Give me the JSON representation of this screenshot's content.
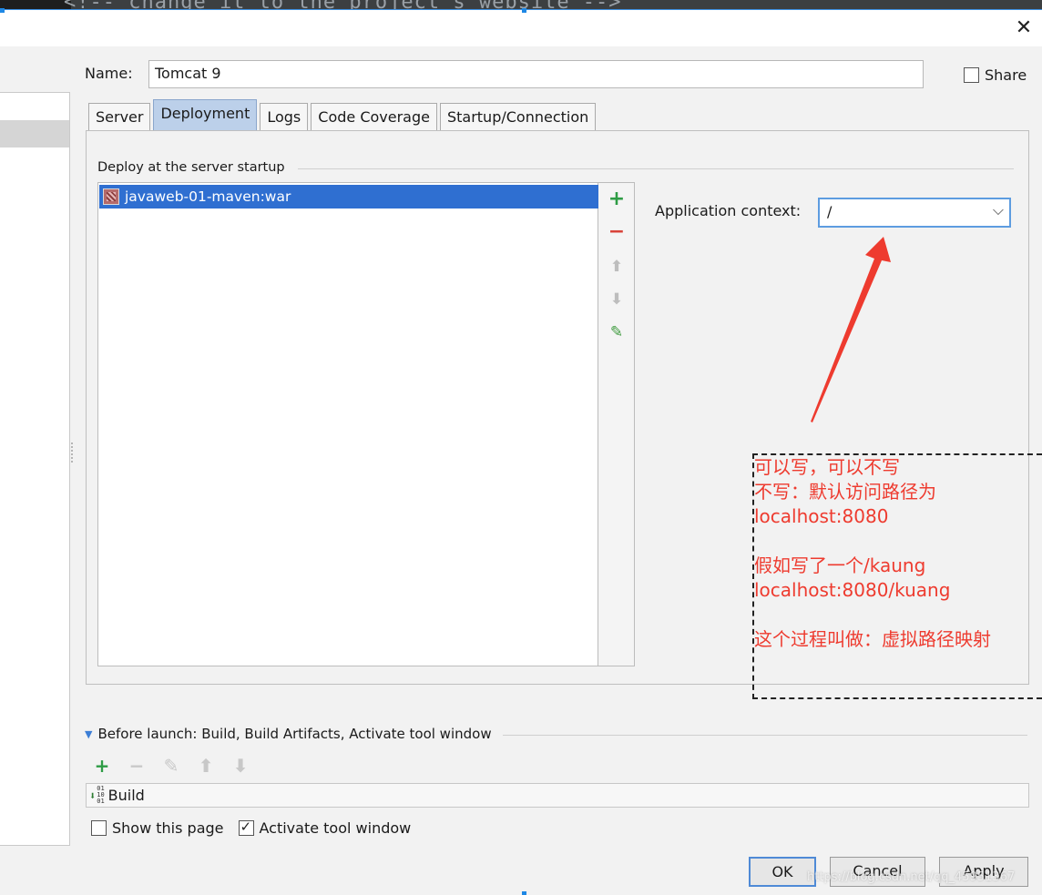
{
  "background_editor": {
    "code_line": "<!-- change it to the project's website -->"
  },
  "dialog": {
    "close_glyph": "✕",
    "name_label": "Name:",
    "name_value": "Tomcat 9",
    "share_label": "Share",
    "share_checked": false,
    "tabs": [
      {
        "label": "Server",
        "active": false
      },
      {
        "label": "Deployment",
        "active": true
      },
      {
        "label": "Logs",
        "active": false
      },
      {
        "label": "Code Coverage",
        "active": false
      },
      {
        "label": "Startup/Connection",
        "active": false
      }
    ],
    "deployment": {
      "section_title": "Deploy at the server startup",
      "artifacts": [
        {
          "name": "javaweb-01-maven:war",
          "icon": "war-artifact-icon",
          "selected": true
        }
      ],
      "toolbar": [
        {
          "name": "add-icon",
          "glyph": "+"
        },
        {
          "name": "remove-icon",
          "glyph": "−"
        },
        {
          "name": "move-up-icon",
          "glyph": "⬆"
        },
        {
          "name": "move-down-icon",
          "glyph": "⬇"
        },
        {
          "name": "edit-icon",
          "glyph": "✎"
        }
      ],
      "context_label": "Application context:",
      "context_value": "/",
      "context_chevron": "⌵"
    },
    "annotation": {
      "color": "#ee3b2f",
      "lines": [
        "可以写，可以不写",
        "不写：默认访问路径为",
        "localhost:8080",
        "",
        "假如写了一个/kaung",
        "localhost:8080/kuang",
        "",
        "这个过程叫做：虚拟路径映射"
      ]
    },
    "before_launch": {
      "label": "Before launch: Build, Build Artifacts, Activate tool window",
      "toolbar": [
        {
          "name": "add-icon",
          "glyph": "+"
        },
        {
          "name": "remove-icon",
          "glyph": "−"
        },
        {
          "name": "edit-icon",
          "glyph": "✎"
        },
        {
          "name": "move-up-icon",
          "glyph": "⬆"
        },
        {
          "name": "move-down-icon",
          "glyph": "⬇"
        }
      ],
      "items": [
        {
          "label": "Build",
          "icon": "build-icon"
        }
      ],
      "show_page_label": "Show this page",
      "show_page_checked": false,
      "activate_label": "Activate tool window",
      "activate_checked": true
    },
    "buttons": {
      "ok": "OK",
      "cancel": "Cancel",
      "apply": "Apply"
    },
    "watermark": "https://blog.csdn.net/qq_45951367"
  }
}
